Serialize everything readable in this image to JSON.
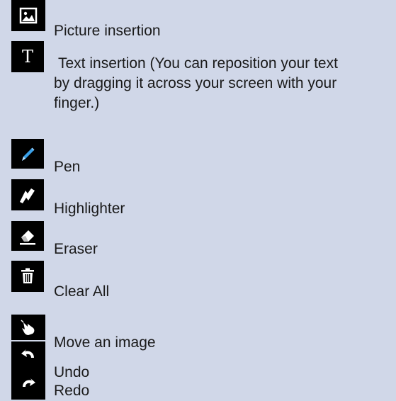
{
  "items": [
    {
      "icon": "picture-icon",
      "label": "Picture insertion"
    },
    {
      "icon": "text-icon",
      "label": "Text insertion (You can reposition your text",
      "label_line2": "by dragging it across your screen with your",
      "label_line3": "finger.)"
    },
    {
      "icon": "pen-icon",
      "label": "Pen"
    },
    {
      "icon": "highlighter-icon",
      "label": "Highlighter"
    },
    {
      "icon": "eraser-icon",
      "label": "Eraser"
    },
    {
      "icon": "trash-icon",
      "label": "Clear All"
    },
    {
      "icon": "move-hand-icon",
      "label": "Move an image"
    },
    {
      "icon": "undo-icon",
      "label": "Undo"
    },
    {
      "icon": "redo-icon",
      "label": "Redo"
    }
  ],
  "colors": {
    "background": "#d0d7e8",
    "icon_bg": "#000000",
    "pen_accent": "#3aa0e8"
  }
}
